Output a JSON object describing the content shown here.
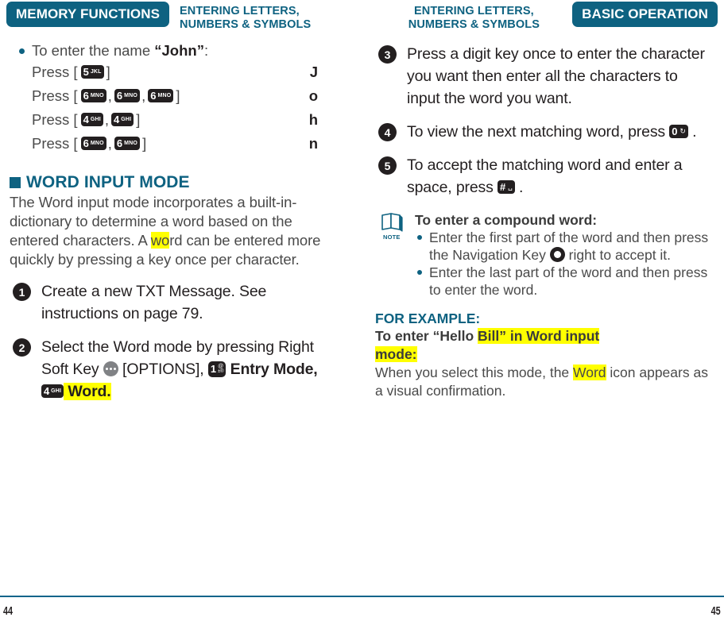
{
  "header": {
    "left_tab": "MEMORY FUNCTIONS",
    "left_caption": "ENTERING LETTERS,\nNUMBERS & SYMBOLS",
    "right_caption": "ENTERING LETTERS,\nNUMBERS & SYMBOLS",
    "right_tab": "BASIC OPERATION",
    "accent_color": "#0e6281"
  },
  "left_column": {
    "name_example": {
      "intro_prefix": "To enter the name ",
      "intro_name": "“John”",
      "intro_suffix": ":",
      "rows": [
        {
          "label": "Press [",
          "keys": [
            {
              "digit": "5",
              "letters": "JKL"
            }
          ],
          "close": "]",
          "result": "J"
        },
        {
          "label": "Press [",
          "keys": [
            {
              "digit": "6",
              "letters": "MNO"
            },
            {
              "digit": "6",
              "letters": "MNO"
            },
            {
              "digit": "6",
              "letters": "MNO"
            }
          ],
          "close": "]",
          "result": "o"
        },
        {
          "label": "Press [",
          "keys": [
            {
              "digit": "4",
              "letters": "GHI"
            },
            {
              "digit": "4",
              "letters": "GHI"
            }
          ],
          "close": "]",
          "result": "h"
        },
        {
          "label": "Press [",
          "keys": [
            {
              "digit": "6",
              "letters": "MNO"
            },
            {
              "digit": "6",
              "letters": "MNO"
            }
          ],
          "close": "]",
          "result": "n"
        }
      ]
    },
    "section_title": "WORD INPUT MODE",
    "section_body_1": "The Word input mode incorporates a built-in-dictionary to determine a word based on the entered characters. A ",
    "section_body_hl": "wo",
    "section_body_2": "rd can be entered more quickly by pressing a key once per character.",
    "steps": [
      {
        "num": "❶",
        "text": "Create a new TXT Message. See instructions on page 79."
      }
    ],
    "step2": {
      "num": "❷",
      "part1": "Select the Word mode by pressing Right Soft Key ",
      "softkey_name": "right-soft-key",
      "part2": " [OPTIONS], ",
      "key1": {
        "digit": "1",
        "top": "@",
        "bottom": "±®"
      },
      "part3": " Entry Mode, ",
      "key2": {
        "digit": "4",
        "letters": "GHI"
      },
      "highlight": " Word."
    }
  },
  "right_column": {
    "steps": [
      {
        "num": "❸",
        "text": "Press a digit key once to enter the character you want then enter all the characters to input the word you want."
      }
    ],
    "step4": {
      "num": "❹",
      "part1": "To view the next matching word, press ",
      "key": {
        "digit": "0",
        "symbol": "↻"
      },
      "part2": " ."
    },
    "step5": {
      "num": "❺",
      "part1": "To accept the matching word and enter a space, press ",
      "key": {
        "digit": "#",
        "symbol": "␣"
      },
      "part2": " ."
    },
    "note": {
      "icon_label": "NOTE",
      "title": "To enter a compound word:",
      "items": [
        {
          "part1": "Enter the first part of the word and then press the Navigation Key ",
          "nav": true,
          "part2": " right to accept it."
        },
        {
          "part1": "Enter the last part of the word and then press  to enter the word.",
          "nav": false,
          "part2": ""
        }
      ]
    },
    "example": {
      "heading": "FOR EXAMPLE:",
      "line1_plain": "To enter “Hello ",
      "line1_hl": "Bill” in Word input",
      "line2_hl": "mode:",
      "body_1": "When you select this mode, the ",
      "body_hl": "Word",
      "body_2": " icon appears as a visual confirmation."
    }
  },
  "footer": {
    "page_left": "44",
    "page_right": "45"
  }
}
